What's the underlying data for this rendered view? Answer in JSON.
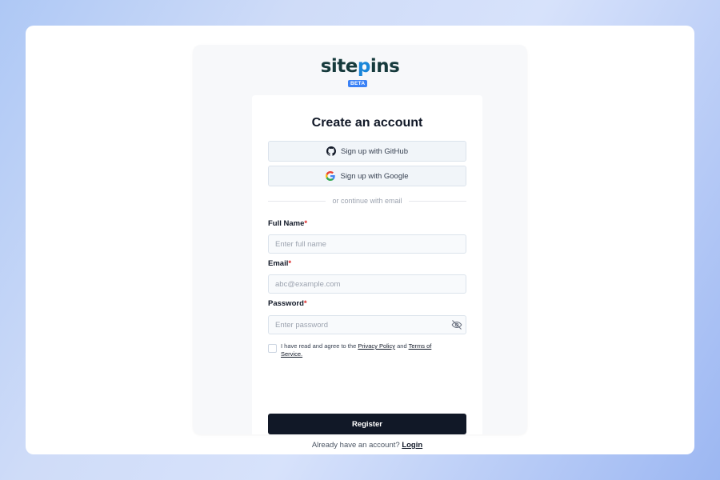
{
  "brand": {
    "logo_pre": "site",
    "logo_pin": "p",
    "logo_post": "ins",
    "badge": "BETA",
    "accent": "#1a86d9"
  },
  "form": {
    "title": "Create an account",
    "github_label": "Sign up with GitHub",
    "google_label": "Sign up with Google",
    "divider_text": "or continue with email",
    "fields": {
      "full_name": {
        "label": "Full Name",
        "required_mark": "*",
        "placeholder": "Enter full name"
      },
      "email": {
        "label": "Email",
        "required_mark": "*",
        "placeholder": "abc@example.com"
      },
      "password": {
        "label": "Password",
        "required_mark": "*",
        "placeholder": "Enter password"
      }
    },
    "agree": {
      "prefix": "I have read and agree to the ",
      "privacy": "Privacy Policy",
      "middle": " and ",
      "terms": "Terms of Service."
    },
    "register_label": "Register",
    "login_prompt": "Already have an account? ",
    "login_link": "Login",
    "icons": {
      "github": "github-icon",
      "google": "google-icon",
      "password_toggle": "eye-off-icon"
    }
  }
}
